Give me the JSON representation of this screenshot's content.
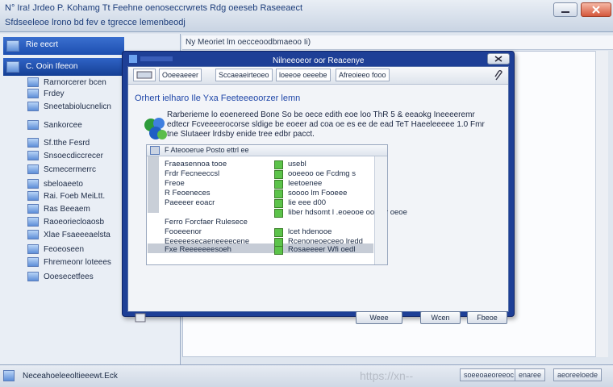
{
  "window": {
    "title_line1": "N° Ira!   Jrdeo P. Kohamg  Tt  Feehne oenoseccrwrets  Rdg  oeeseb  Raseeaect",
    "title_line2": "Sfdseeleoe lrono bd fev e tgrecce lemenbeodj",
    "controls": {
      "minimize_icon": "minimize-icon",
      "restore_icon": "restore-icon",
      "close_icon": "close-icon"
    },
    "accent": "#1e3f96"
  },
  "sidebar": {
    "header": "Rie eecrt",
    "header2": "C. Ooin Ifeeon",
    "items": [
      {
        "label": "Rarnorcerer bcen"
      },
      {
        "label": "Frdey"
      },
      {
        "label": "Sneetabiolucnelicn"
      },
      {
        "label": "Sankorcee"
      },
      {
        "label": "Sf.tthe Fesrd"
      },
      {
        "label": "Snsoecdiccrecer"
      },
      {
        "label": "Scmecermerrc"
      },
      {
        "label": "sbeloaeeto"
      },
      {
        "label": "Rai.    Foeb   MeiLtt."
      },
      {
        "label": "Ras   Beeaem"
      },
      {
        "label": "Raoeoriecloaosb"
      },
      {
        "label": "Xlae  Fsaeeeaelsta"
      },
      {
        "label": "Feoeoseen"
      },
      {
        "label": "Fhremeonr loteees"
      },
      {
        "label": "Ooesecetfees"
      }
    ]
  },
  "address": "Ny Meoriet lm oecceoodbmaeoo Ii)",
  "dialog": {
    "title": "Nilneeoeor oor Reacenye",
    "toolbar": [
      "Ooeeaeeer",
      "Sccaeaeirteoeo",
      "loeeoe oeeebe",
      "Afreoieeo fooo"
    ],
    "heading": "Orhert  ielharo   Ile  Yxa  Feeteeeoorzer  lemn",
    "description": "Rarberieme   lo  eoenereed  Bone  So  be  oece  edith eoe  loo  ThR  5 &   eeaokg  Ineeeeremr  edtecr  Fcveeeerocorse  sldige  be  eoeer  ad  coa  oe  es  ee  de  ead  TeT  Haeeleeeee      1.0 Fmr  tne  Slutaeer  lrdsby  enide tree edbr pacct.",
    "table": {
      "header": "F     Ateooerue      Posto  ettrl  ee",
      "rows": [
        {
          "left": "Fraeasennoa  tooe",
          "right": "usebl"
        },
        {
          "left": "Frdr  Fecneeccsl",
          "right": "ooeeoo  oe  Fcdmg s"
        },
        {
          "left": "Freoe",
          "right": "Ieetoenee"
        },
        {
          "left": "R   Feoeneces",
          "right": "soooo  lm  Fooeee"
        },
        {
          "left": "Paeeeer  eoacr",
          "right": "Iie eee  d00"
        },
        {
          "left": "",
          "right": "Iiber  hdsomt      l .eoeooe  ooerer  oeoe"
        },
        {
          "left": "Ferro  Forcfaer   Rulesece",
          "right": ""
        },
        {
          "left": "Fooeeenor",
          "right": "lcet  hdenooe"
        },
        {
          "left": "Eeeeeesecaeneeeecene",
          "right": "Rcenoneoeceeo  lredd"
        },
        {
          "left": "Fxe  Reeeeeeesoeh",
          "right": "Rosaeeeer  Wfi  oedl"
        }
      ]
    },
    "buttons": [
      "Weee",
      "Wcen",
      "Fbeoe"
    ]
  },
  "status": {
    "text": "Neceahoeleeoltieeewt.Eck",
    "buttons": [
      "soeeoaeoreeoc",
      "enaree",
      "aeoreeloede"
    ],
    "watermark": "https://xn--"
  }
}
